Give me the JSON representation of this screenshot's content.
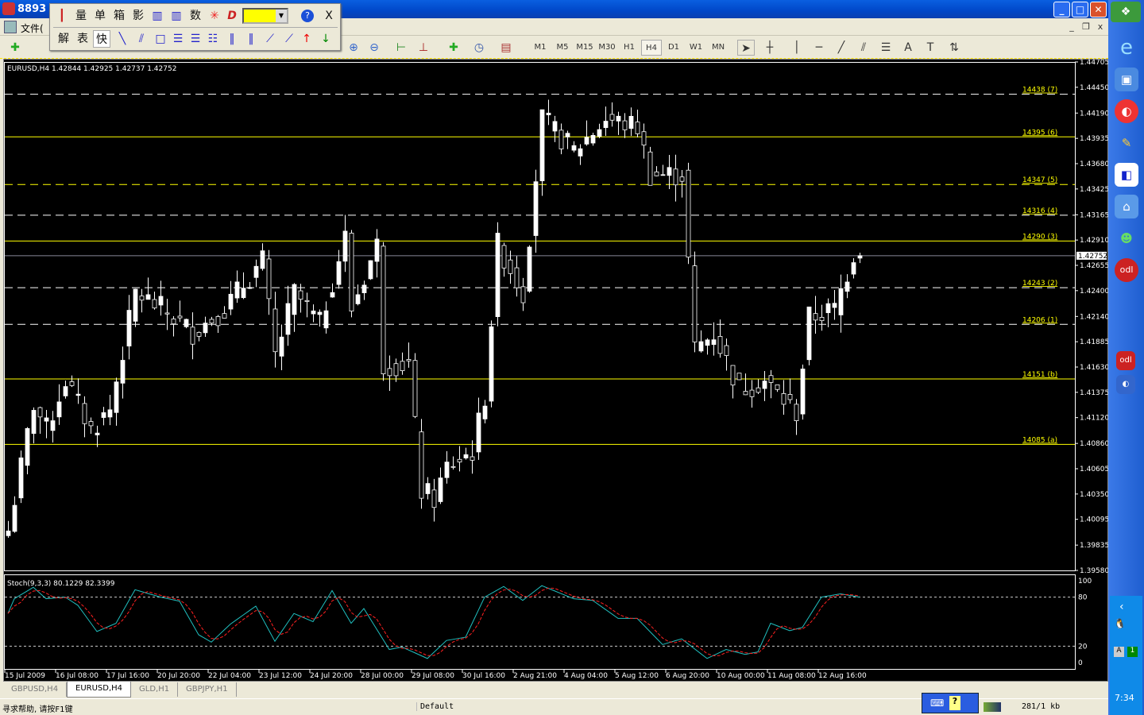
{
  "window": {
    "title": "8893",
    "minimize": "_",
    "maximize": "□",
    "close": "✕"
  },
  "menubar": {
    "first_menu": "文件(",
    "mdi_minimize": "_",
    "mdi_restore": "❐",
    "mdi_close": "x"
  },
  "floating_toolbar": {
    "row1": [
      "量",
      "单",
      "箱",
      "影",
      "数"
    ],
    "row2": [
      "解",
      "表",
      "快"
    ],
    "color_value": "#ffff00",
    "help": "?",
    "close": "X"
  },
  "toolbar": {
    "timeframes": [
      "M1",
      "M5",
      "M15",
      "M30",
      "H1",
      "H4",
      "D1",
      "W1",
      "MN"
    ],
    "selected_timeframe": "H4",
    "draw_tools": [
      "cursor",
      "crosshair",
      "vertical-line",
      "horizontal-line",
      "trendline",
      "fibo-channel",
      "fibo-levels",
      "text",
      "label",
      "arrows"
    ],
    "text_tool_label": "A",
    "label_tool_label": "T"
  },
  "chart": {
    "header": "EURUSD,H4  1.42844 1.42925 1.42737 1.42752",
    "current_price": "1.42752",
    "colors": {
      "background": "#000000",
      "bull": "#ffffff",
      "bear": "#000000",
      "level_yellow": "#ffff00",
      "stoch_main": "#20c0c0",
      "stoch_signal": "#ff2020"
    }
  },
  "chart_data": {
    "type": "candlestick",
    "symbol": "EURUSD",
    "timeframe": "H4",
    "ylim": [
      1.3958,
      1.44705
    ],
    "y_ticks": [
      "1.44705",
      "1.44450",
      "1.44190",
      "1.43935",
      "1.43680",
      "1.43425",
      "1.43165",
      "1.42910",
      "1.42655",
      "1.42400",
      "1.42140",
      "1.41885",
      "1.41630",
      "1.41375",
      "1.41120",
      "1.40860",
      "1.40605",
      "1.40350",
      "1.40095",
      "1.39835",
      "1.39580"
    ],
    "x_ticks": [
      "15 Jul 2009",
      "16 Jul 08:00",
      "17 Jul 16:00",
      "20 Jul 20:00",
      "22 Jul 04:00",
      "23 Jul 12:00",
      "24 Jul 20:00",
      "28 Jul 00:00",
      "29 Jul 08:00",
      "30 Jul 16:00",
      "2 Aug 21:00",
      "4 Aug 04:00",
      "5 Aug 12:00",
      "6 Aug 20:00",
      "10 Aug 00:00",
      "11 Aug 08:00",
      "12 Aug 16:00"
    ],
    "bar_count": 135,
    "close_path": [
      [
        0,
        1.3998
      ],
      [
        4,
        1.4126
      ],
      [
        6,
        1.41
      ],
      [
        9,
        1.415
      ],
      [
        13,
        1.41
      ],
      [
        16,
        1.412
      ],
      [
        20,
        1.4238
      ],
      [
        24,
        1.4222
      ],
      [
        29,
        1.4198
      ],
      [
        34,
        1.4222
      ],
      [
        40,
        1.427
      ],
      [
        42,
        1.4174
      ],
      [
        45,
        1.4238
      ],
      [
        49,
        1.4206
      ],
      [
        53,
        1.4294
      ],
      [
        54,
        1.4222
      ],
      [
        58,
        1.4286
      ],
      [
        59,
        1.4166
      ],
      [
        63,
        1.4166
      ],
      [
        65,
        1.4038
      ],
      [
        67,
        1.403
      ],
      [
        69,
        1.4062
      ],
      [
        73,
        1.4078
      ],
      [
        75,
        1.4134
      ],
      [
        77,
        1.4286
      ],
      [
        81,
        1.4238
      ],
      [
        84,
        1.4413
      ],
      [
        89,
        1.4381
      ],
      [
        94,
        1.4413
      ],
      [
        99,
        1.4405
      ],
      [
        101,
        1.4357
      ],
      [
        106,
        1.4357
      ],
      [
        108,
        1.4181
      ],
      [
        111,
        1.4197
      ],
      [
        115,
        1.4141
      ],
      [
        119,
        1.4149
      ],
      [
        124,
        1.4117
      ],
      [
        126,
        1.4213
      ],
      [
        130,
        1.4221
      ],
      [
        133,
        1.4277
      ],
      [
        134,
        1.42752
      ]
    ],
    "levels": [
      {
        "label": "14438 (7)",
        "price": 1.4438,
        "color": "#ffffff",
        "style": "dashed"
      },
      {
        "label": "14395 (6)",
        "price": 1.4395,
        "color": "#ffff00",
        "style": "solid"
      },
      {
        "label": "14347 (5)",
        "price": 1.4347,
        "color": "#ffff00",
        "style": "dashed"
      },
      {
        "label": "14316 (4)",
        "price": 1.4316,
        "color": "#ffffff",
        "style": "dashed"
      },
      {
        "label": "14290 (3)",
        "price": 1.429,
        "color": "#ffff00",
        "style": "solid"
      },
      {
        "label": "14243 (2)",
        "price": 1.4243,
        "color": "#ffffff",
        "style": "dashed"
      },
      {
        "label": "14206 (1)",
        "price": 1.4206,
        "color": "#ffffff",
        "style": "dashed"
      },
      {
        "label": "14151 (b)",
        "price": 1.4151,
        "color": "#ffff00",
        "style": "solid"
      },
      {
        "label": "14085 (a)",
        "price": 1.4085,
        "color": "#ffff00",
        "style": "solid"
      }
    ],
    "stochastic": {
      "header": "Stoch(9,3,3) 80.1229 82.3399",
      "ylim": [
        0,
        100
      ],
      "y_ticks": [
        "100",
        "80",
        "20",
        "0"
      ],
      "levels": [
        80,
        20
      ],
      "main_path": [
        [
          0,
          60
        ],
        [
          1,
          78
        ],
        [
          4,
          92
        ],
        [
          6,
          78
        ],
        [
          9,
          80
        ],
        [
          11,
          70
        ],
        [
          14,
          38
        ],
        [
          17,
          48
        ],
        [
          20,
          89
        ],
        [
          24,
          80
        ],
        [
          27,
          75
        ],
        [
          30,
          34
        ],
        [
          32,
          25
        ],
        [
          35,
          47
        ],
        [
          39,
          69
        ],
        [
          42,
          26
        ],
        [
          45,
          60
        ],
        [
          48,
          50
        ],
        [
          51,
          88
        ],
        [
          54,
          48
        ],
        [
          56,
          66
        ],
        [
          60,
          16
        ],
        [
          62,
          19
        ],
        [
          66,
          5
        ],
        [
          69,
          27
        ],
        [
          72,
          31
        ],
        [
          75,
          80
        ],
        [
          78,
          93
        ],
        [
          81,
          76
        ],
        [
          84,
          94
        ],
        [
          89,
          78
        ],
        [
          92,
          76
        ],
        [
          96,
          54
        ],
        [
          99,
          54
        ],
        [
          103,
          22
        ],
        [
          106,
          29
        ],
        [
          110,
          5
        ],
        [
          113,
          16
        ],
        [
          116,
          10
        ],
        [
          118,
          13
        ],
        [
          120,
          48
        ],
        [
          123,
          39
        ],
        [
          125,
          43
        ],
        [
          128,
          80
        ],
        [
          131,
          84
        ],
        [
          134,
          80
        ]
      ]
    }
  },
  "tabs": [
    "GBPUSD,H4",
    "EURUSD,H4",
    "GLD,H1",
    "GBPJPY,H1"
  ],
  "active_tab": "EURUSD,H4",
  "statusbar": {
    "help": "寻求帮助, 请按F1键",
    "profile": "Default",
    "traffic": "281/1 kb"
  },
  "taskbar": {
    "clock": "7:34"
  }
}
